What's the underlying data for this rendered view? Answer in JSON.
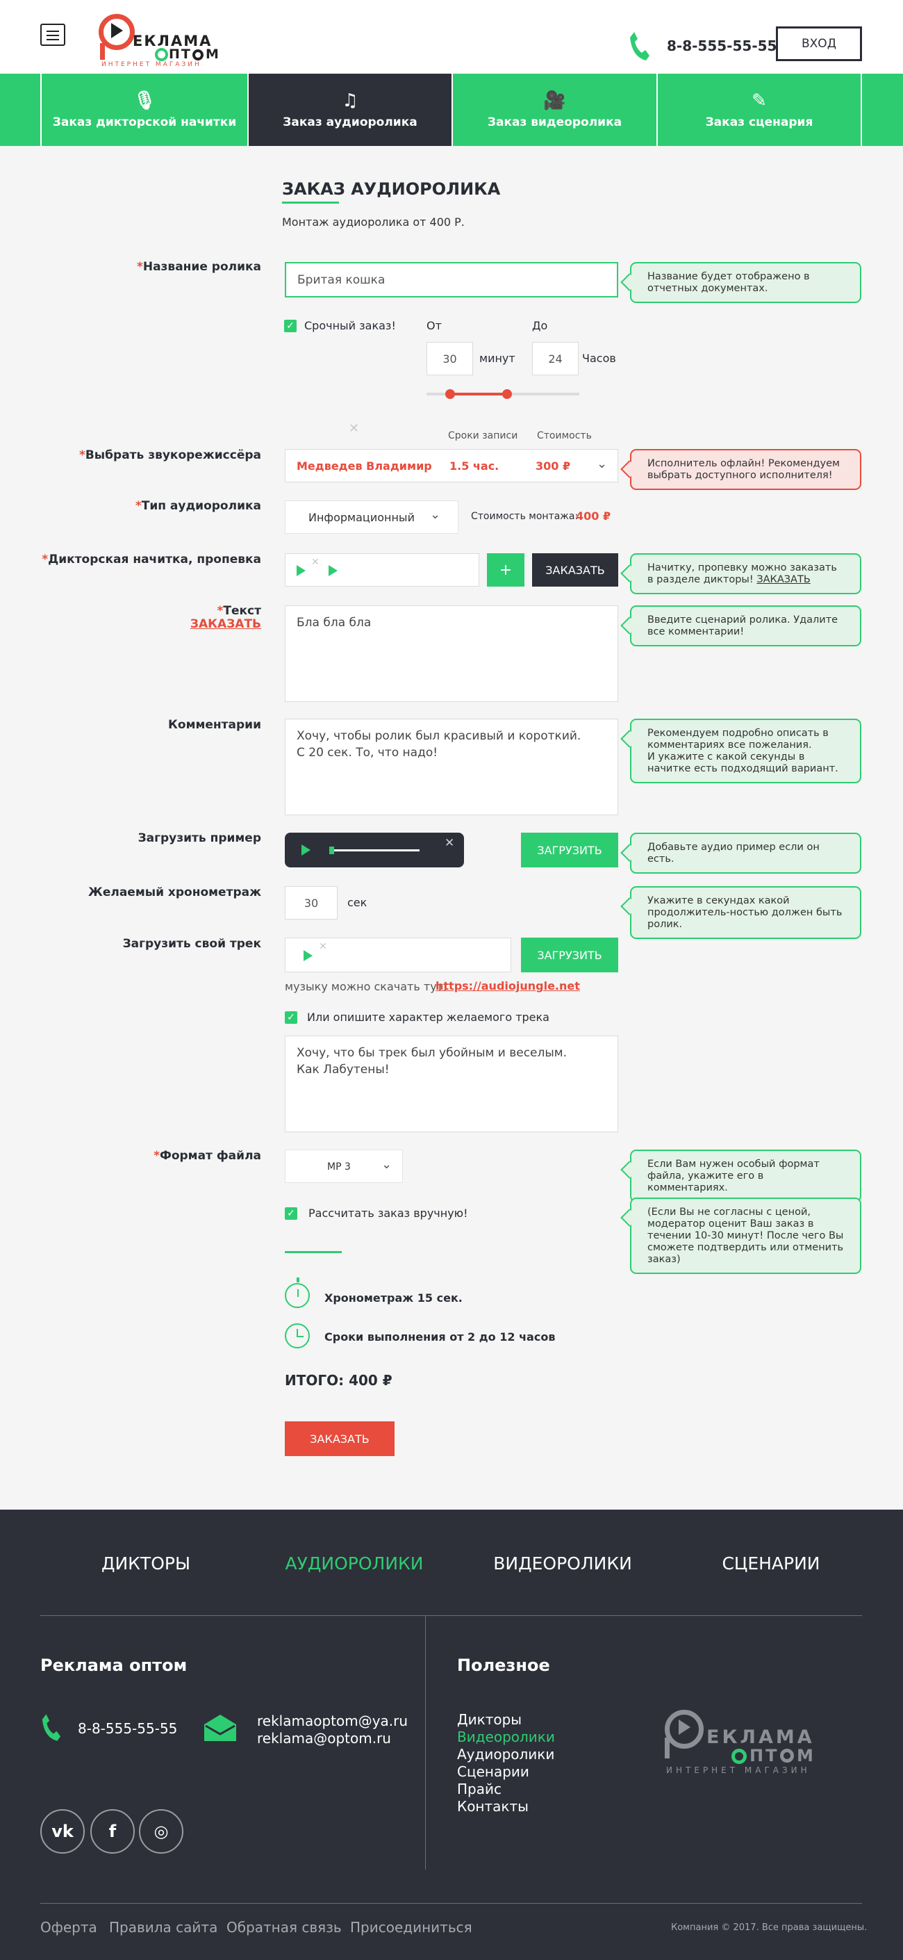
{
  "header": {
    "logo_line1": "ЕКЛАМА",
    "logo_line2": "ПТ",
    "logo_line2b": "М",
    "logo_sub": "ИНТЕРНЕТ МАГАЗИН",
    "phone": "8-8-555-55-55",
    "login": "ВХОД"
  },
  "nav": [
    {
      "label": "Заказ дикторской начитки",
      "icon": "microphone-icon"
    },
    {
      "label": "Заказ аудиоролика",
      "icon": "music-note-icon"
    },
    {
      "label": "Заказ видеоролика",
      "icon": "video-camera-icon"
    },
    {
      "label": "Заказ сценария",
      "icon": "script-icon"
    }
  ],
  "page": {
    "title": "ЗАКАЗ АУДИОРОЛИКА",
    "subtitle": "Монтаж аудиоролика от 400 Р."
  },
  "form": {
    "name_label": "Название ролика",
    "name_value": "Бритая кошка",
    "name_tip": "Название будет отображено в отчетных документах.",
    "urgent_label": "Срочный заказ!",
    "from_label": "От",
    "to_label": "До",
    "from_value": "30",
    "from_unit": "минут",
    "to_value": "24",
    "to_unit": "Часов",
    "engineer_label": "Выбрать звукорежиссёра",
    "col_terms": "Сроки записи",
    "col_cost": "Стоимость",
    "engineer_name": "Медведев Владимир",
    "engineer_time": "1.5 час.",
    "engineer_price": "300 ₽",
    "engineer_tip": "Исполнитель офлайн! Рекомендуем выбрать доступного исполнителя!",
    "type_label": "Тип аудиоролика",
    "type_value": "Информационный",
    "mount_cost_label": "Стоимость монтажа:",
    "mount_cost_value": "400 ₽",
    "voice_label": "Дикторская начитка, пропевка",
    "plus": "+",
    "order_btn": "ЗАКАЗАТЬ",
    "voice_tip_a": "Начитку, пропевку можно заказать в разделе дикторы! ",
    "voice_tip_link": "ЗАКАЗАТЬ",
    "text_label": "Текст",
    "text_order": "ЗАКАЗАТЬ",
    "text_value": "Бла бла бла",
    "text_tip": "Введите сценарий ролика. Удалите все комментарии!",
    "comments_label": "Комментарии",
    "comments_value": "Хочу, чтобы ролик был красивый и короткий.\nС 20 сек. То, что надо!",
    "comments_tip": "Рекомендуем подробно описать в комментариях все пожелания.\nИ укажите с какой секунды в начитке есть подходящий вариант.",
    "example_label": "Загрузить пример",
    "upload_btn": "ЗАГРУЗИТЬ",
    "example_tip": "Добавьте аудио пример если он есть.",
    "example_progress": 0.05,
    "duration_label": "Желаемый хронометраж",
    "duration_value": "30",
    "duration_unit": "сек",
    "duration_tip": "Укажите в секундах какой продолжитель-ностью должен быть ролик.",
    "track_label": "Загрузить свой трек",
    "music_text": "музыку можно скачать тут:",
    "music_link": "https://audiojungle.net",
    "describe_label": "Или опишите характер желаемого трека",
    "describe_value": "Хочу, что бы трек был убойным и веселым.\nКак Лабутены!",
    "format_label": "Формат файла",
    "format_value": "MP 3",
    "format_tip": "Если Вам нужен особый формат файла, укажите его в комментариях.",
    "manual_label": "Рассчитать заказ вручную!",
    "manual_tip": "(Если Вы не согласны с ценой, модератор оценит Ваш заказ в течении 10-30 минут! После чего Вы сможете подтвердить или отменить заказ)"
  },
  "summary": {
    "duration": "Хронометраж 15 сек.",
    "terms": "Сроки выполнения от 2 до 12 часов",
    "total": "ИТОГО: 400 ₽",
    "order_btn": "ЗАКАЗАТЬ"
  },
  "footer": {
    "cats": [
      "ДИКТОРЫ",
      "АУДИОРОЛИКИ",
      "ВИДЕОРОЛИКИ",
      "СЦЕНАРИИ"
    ],
    "brand": "Реклама оптом",
    "phone": "8-8-555-55-55",
    "email1": "reklamaoptom@ya.ru",
    "email2": "reklama@optom.ru",
    "useful": "Полезное",
    "links": [
      "Дикторы",
      "Видеоролики",
      "Аудиоролики",
      "Сценарии",
      "Прайс",
      "Контакты"
    ],
    "bottom": [
      "Оферта",
      "Правила сайта",
      "Обратная связь",
      "Присоединиться"
    ],
    "copyright": "Компания © 2017. Все права защищены.",
    "social": [
      "vk",
      "f",
      "ig"
    ]
  },
  "colors": {
    "green": "#2ecc71",
    "red": "#e74c3c",
    "dark": "#2d3039"
  }
}
